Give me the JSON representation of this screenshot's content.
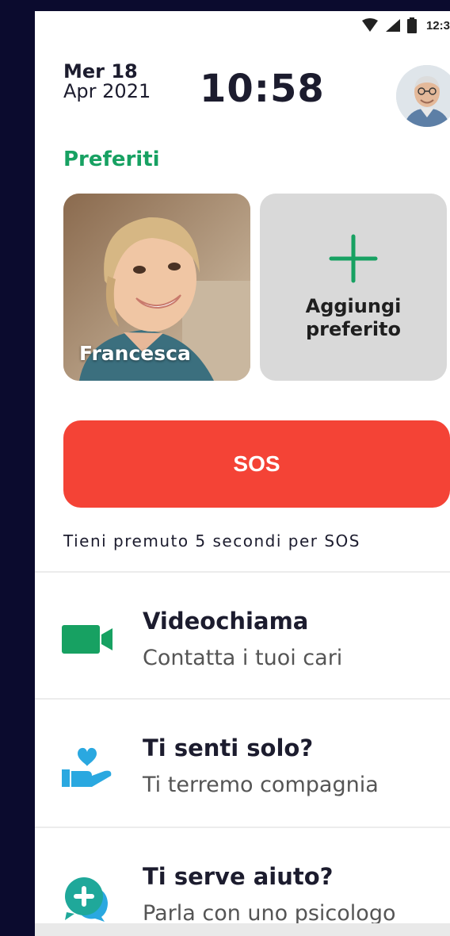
{
  "status_bar": {
    "time": "12:3",
    "icons": [
      "wifi-icon",
      "signal-icon",
      "battery-icon"
    ]
  },
  "header": {
    "day": "Mer 18",
    "month_year": "Apr 2021",
    "clock": "10:58",
    "avatar_icon": "user-avatar"
  },
  "favorites": {
    "title": "Preferiti",
    "items": [
      {
        "name": "Francesca"
      }
    ],
    "add_label_line1": "Aggiungi",
    "add_label_line2": "preferito"
  },
  "sos": {
    "label": "SOS",
    "hint": "Tieni premuto 5 secondi per SOS",
    "color": "#f44336"
  },
  "actions": [
    {
      "title": "Videochiama",
      "subtitle": "Contatta i tuoi cari",
      "icon": "video-camera-icon"
    },
    {
      "title": "Ti senti solo?",
      "subtitle": "Ti terremo compagnia",
      "icon": "heart-hand-icon"
    },
    {
      "title": "Ti serve aiuto?",
      "subtitle": "Parla con uno psicologo",
      "icon": "medical-chat-icon"
    }
  ],
  "colors": {
    "accent_green": "#17a162",
    "icon_blue": "#2aa8e0",
    "sos_red": "#f44336"
  }
}
